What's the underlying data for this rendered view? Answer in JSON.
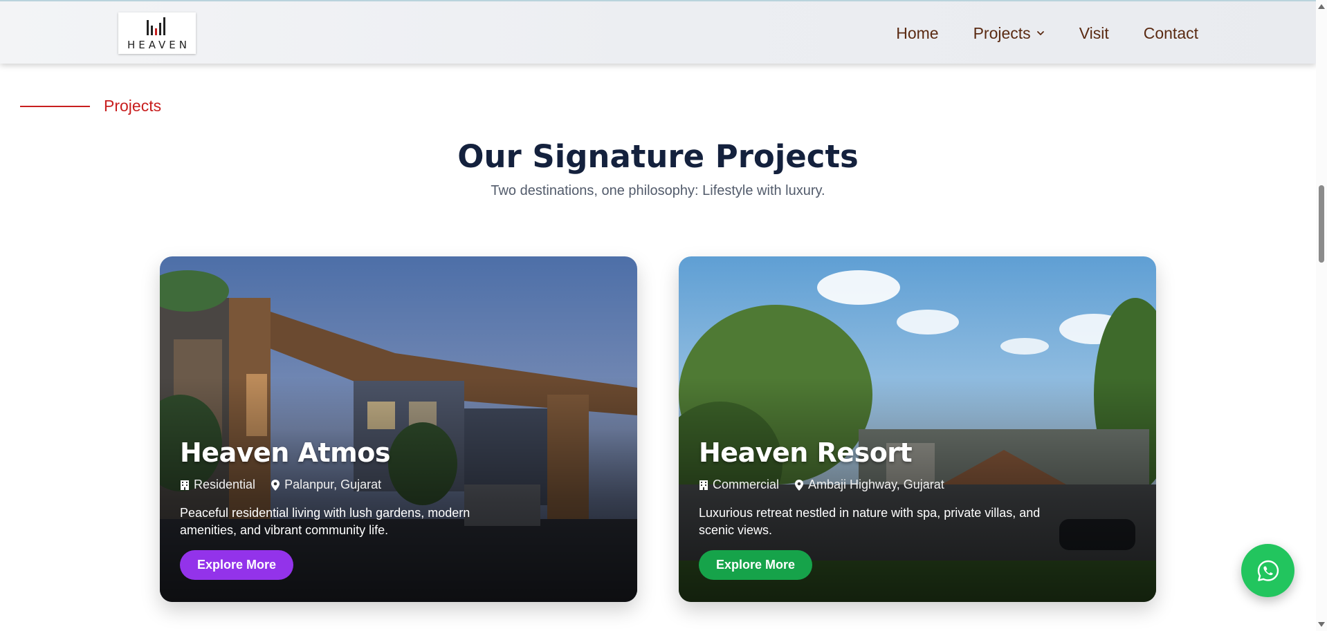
{
  "header": {
    "logo_text": "HEAVEN",
    "nav": [
      {
        "label": "Home"
      },
      {
        "label": "Projects"
      },
      {
        "label": "Visit"
      },
      {
        "label": "Contact"
      }
    ]
  },
  "section": {
    "eyebrow": "Projects",
    "title": "Our Signature Projects",
    "subtitle": "Two destinations, one philosophy: Lifestyle with luxury."
  },
  "projects": [
    {
      "title": "Heaven Atmos",
      "type": "Residential",
      "location": "Palanpur, Gujarat",
      "description": "Peaceful residential living with lush gardens, modern amenities, and vibrant community life.",
      "button": "Explore More",
      "button_color": "#9333ea"
    },
    {
      "title": "Heaven Resort",
      "type": "Commercial",
      "location": "Ambaji Highway, Gujarat",
      "description": "Luxurious retreat nestled in nature with spa, private villas, and scenic views.",
      "button": "Explore More",
      "button_color": "#16a34a"
    }
  ],
  "colors": {
    "accent_red": "#c81e1e",
    "nav_text": "#5a2a12",
    "title_text": "#14213d",
    "whatsapp": "#22c55e"
  },
  "icons": {
    "building": "building-icon",
    "location": "map-pin-icon",
    "whatsapp": "whatsapp-icon",
    "chevron": "chevron-down-icon"
  }
}
